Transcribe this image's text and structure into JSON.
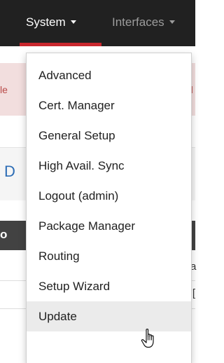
{
  "navbar": {
    "system_label": "System",
    "interfaces_label": "Interfaces"
  },
  "menu": {
    "items": [
      {
        "label": "Advanced"
      },
      {
        "label": "Cert. Manager"
      },
      {
        "label": "General Setup"
      },
      {
        "label": "High Avail. Sync"
      },
      {
        "label": "Logout (admin)"
      },
      {
        "label": "Package Manager"
      },
      {
        "label": "Routing"
      },
      {
        "label": "Setup Wizard"
      },
      {
        "label": "Update"
      }
    ],
    "hovered_item": "Update"
  },
  "background": {
    "alert_left_fragment": "le",
    "alert_right_fragment": "d",
    "blue_fragment": "D",
    "header_fragment": "o",
    "row1_fragment": "a",
    "row2_fragment": "'["
  },
  "colors": {
    "navbar_bg": "#212121",
    "active_indicator": "#c8272d",
    "alert_bg": "#f2dede",
    "menu_hover_bg": "#ebebeb"
  },
  "icons": {
    "cursor": "hand-pointer-icon",
    "nav_caret": "caret-down-icon"
  }
}
